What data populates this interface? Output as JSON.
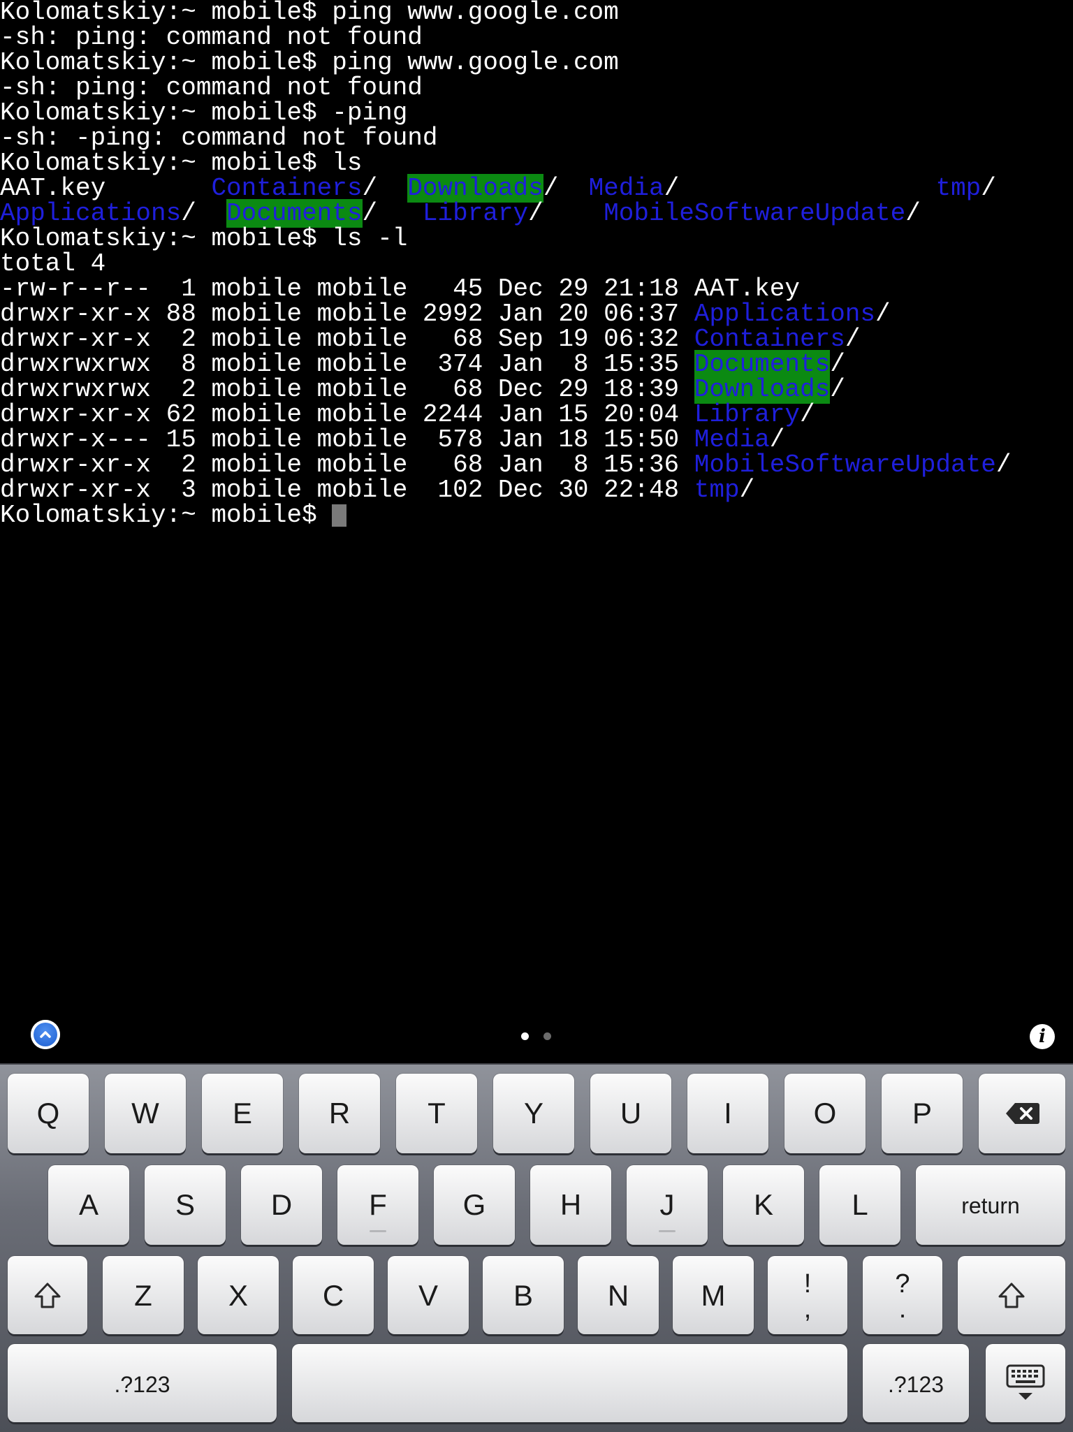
{
  "terminal": {
    "lines": [
      [
        {
          "t": "Kolomatskiy:~ mobile$ ping www.google.com"
        }
      ],
      [
        {
          "t": "-sh: ping: command not found"
        }
      ],
      [
        {
          "t": "Kolomatskiy:~ mobile$ ping www.google.com"
        }
      ],
      [
        {
          "t": "-sh: ping: command not found"
        }
      ],
      [
        {
          "t": "Kolomatskiy:~ mobile$ -ping"
        }
      ],
      [
        {
          "t": "-sh: -ping: command not found"
        }
      ],
      [
        {
          "t": "Kolomatskiy:~ mobile$ ls"
        }
      ],
      [
        {
          "t": "AAT.key       "
        },
        {
          "t": "Containers",
          "c": "dir"
        },
        {
          "t": "/  "
        },
        {
          "t": "Downloads",
          "c": "hl"
        },
        {
          "t": "/  "
        },
        {
          "t": "Media",
          "c": "dir"
        },
        {
          "t": "/                 "
        },
        {
          "t": "tmp",
          "c": "dir"
        },
        {
          "t": "/"
        }
      ],
      [
        {
          "t": "Applications",
          "c": "dir"
        },
        {
          "t": "/  "
        },
        {
          "t": "Documents",
          "c": "hl"
        },
        {
          "t": "/   "
        },
        {
          "t": "Library",
          "c": "dir"
        },
        {
          "t": "/    "
        },
        {
          "t": "MobileSoftwareUpdate",
          "c": "dir"
        },
        {
          "t": "/"
        }
      ],
      [
        {
          "t": "Kolomatskiy:~ mobile$ ls -l"
        }
      ],
      [
        {
          "t": "total 4"
        }
      ],
      [
        {
          "t": "-rw-r--r--  1 mobile mobile   45 Dec 29 21:18 AAT.key"
        }
      ],
      [
        {
          "t": "drwxr-xr-x 88 mobile mobile 2992 Jan 20 06:37 "
        },
        {
          "t": "Applications",
          "c": "dir"
        },
        {
          "t": "/"
        }
      ],
      [
        {
          "t": "drwxr-xr-x  2 mobile mobile   68 Sep 19 06:32 "
        },
        {
          "t": "Containers",
          "c": "dir"
        },
        {
          "t": "/"
        }
      ],
      [
        {
          "t": "drwxrwxrwx  8 mobile mobile  374 Jan  8 15:35 "
        },
        {
          "t": "Documents",
          "c": "hl"
        },
        {
          "t": "/"
        }
      ],
      [
        {
          "t": "drwxrwxrwx  2 mobile mobile   68 Dec 29 18:39 "
        },
        {
          "t": "Downloads",
          "c": "hl"
        },
        {
          "t": "/"
        }
      ],
      [
        {
          "t": "drwxr-xr-x 62 mobile mobile 2244 Jan 15 20:04 "
        },
        {
          "t": "Library",
          "c": "dir"
        },
        {
          "t": "/"
        }
      ],
      [
        {
          "t": "drwxr-x--- 15 mobile mobile  578 Jan 18 15:50 "
        },
        {
          "t": "Media",
          "c": "dir"
        },
        {
          "t": "/"
        }
      ],
      [
        {
          "t": "drwxr-xr-x  2 mobile mobile   68 Jan  8 15:36 "
        },
        {
          "t": "MobileSoftwareUpdate",
          "c": "dir"
        },
        {
          "t": "/"
        }
      ],
      [
        {
          "t": "drwxr-xr-x  3 mobile mobile  102 Dec 30 22:48 "
        },
        {
          "t": "tmp",
          "c": "dir"
        },
        {
          "t": "/"
        }
      ],
      [
        {
          "t": "Kolomatskiy:~ mobile$ "
        },
        {
          "t": "",
          "c": "cursor"
        }
      ]
    ]
  },
  "colors": {
    "directory": "#1f1fdc",
    "highlight_bg": "#0b8a12",
    "cursor": "#7a7a7a",
    "page_dot_active": "#ffffff",
    "page_dot_inactive": "#6b6b6b"
  },
  "accessory": {
    "up_icon": "chevron-up-icon",
    "info_label": "i",
    "page_dots": 2,
    "active_page": 0
  },
  "keyboard": {
    "row1": [
      "Q",
      "W",
      "E",
      "R",
      "T",
      "Y",
      "U",
      "I",
      "O",
      "P"
    ],
    "row2": [
      "A",
      "S",
      "D",
      "F",
      "G",
      "H",
      "J",
      "K",
      "L"
    ],
    "row3": [
      "Z",
      "X",
      "C",
      "V",
      "B",
      "N",
      "M"
    ],
    "return_label": "return",
    "punct1": {
      "top": "!",
      "bottom": ","
    },
    "punct2": {
      "top": "?",
      "bottom": "."
    },
    "numbers_label_left": ".?123",
    "numbers_label_right": ".?123",
    "icons": {
      "backspace": "backspace-icon",
      "shift": "shift-icon",
      "hide_keyboard": "keyboard-hide-icon"
    }
  }
}
